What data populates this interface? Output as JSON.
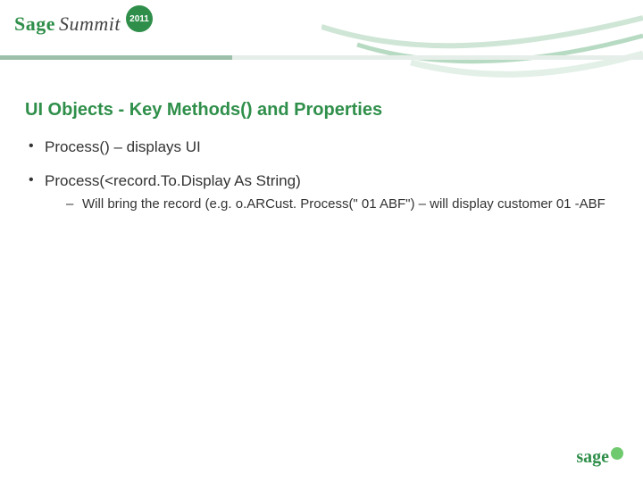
{
  "header": {
    "brand_word1": "Sage",
    "brand_word2": "Summit",
    "year_badge": "2011"
  },
  "slide": {
    "title": "UI Objects - Key Methods() and Properties",
    "bullets": [
      {
        "text": "Process() – displays UI",
        "children": []
      },
      {
        "text": "Process(<record.To.Display As String)",
        "children": [
          "Will bring the record (e.g. o.ARCust. Process(\" 01 ABF\") – will display customer 01 -ABF"
        ]
      }
    ]
  },
  "footer": {
    "brand": "sage"
  }
}
